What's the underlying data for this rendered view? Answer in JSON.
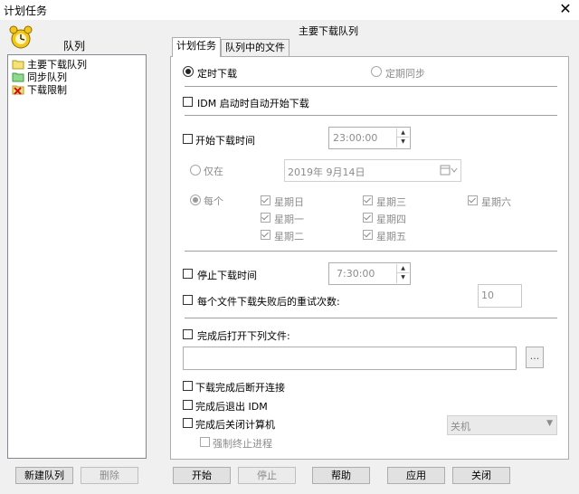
{
  "window": {
    "title": "计划任务",
    "close_glyph": "✕"
  },
  "sidebar": {
    "header": "队列",
    "icon": "scheduler-clock-icon",
    "items": [
      {
        "label": "主要下载队列",
        "icon": "folder-icon",
        "selected": true
      },
      {
        "label": "同步队列",
        "icon": "folder-sync-icon",
        "selected": false
      },
      {
        "label": "下载限制",
        "icon": "limit-x-icon",
        "selected": false
      }
    ],
    "new_queue_label": "新建队列",
    "delete_label": "删除"
  },
  "panel": {
    "title": "主要下载队列",
    "tabs": [
      {
        "label": "计划任务",
        "active": true
      },
      {
        "label": "队列中的文件",
        "active": false
      }
    ]
  },
  "schedule": {
    "mode_timed": "定时下载",
    "mode_periodic": "定期同步",
    "idm_start_auto": "IDM 启动时自动开始下载",
    "start_time_label": "开始下载时间",
    "start_time_value": "23:00:00",
    "only_on_label": "仅在",
    "date_value": "2019年  9月14日",
    "every_label": "每个",
    "weekdays": {
      "sun": "星期日",
      "mon": "星期一",
      "tue": "星期二",
      "wed": "星期三",
      "thu": "星期四",
      "fri": "星期五",
      "sat": "星期六"
    },
    "stop_time_label": "停止下载时间",
    "stop_time_value": "7:30:00",
    "retry_label": "每个文件下载失败后的重试次数:",
    "retry_value": "10",
    "open_file_label": "完成后打开下列文件:",
    "open_file_value": "",
    "browse_label": "...",
    "hangup_label": "下载完成后断开连接",
    "exit_idm_label": "完成后退出 IDM",
    "shutdown_label": "完成后关闭计算机",
    "shutdown_option": "关机",
    "force_kill_label": "强制终止进程"
  },
  "footer": {
    "start": "开始",
    "stop": "停止",
    "help": "帮助",
    "apply": "应用",
    "close": "关闭"
  }
}
